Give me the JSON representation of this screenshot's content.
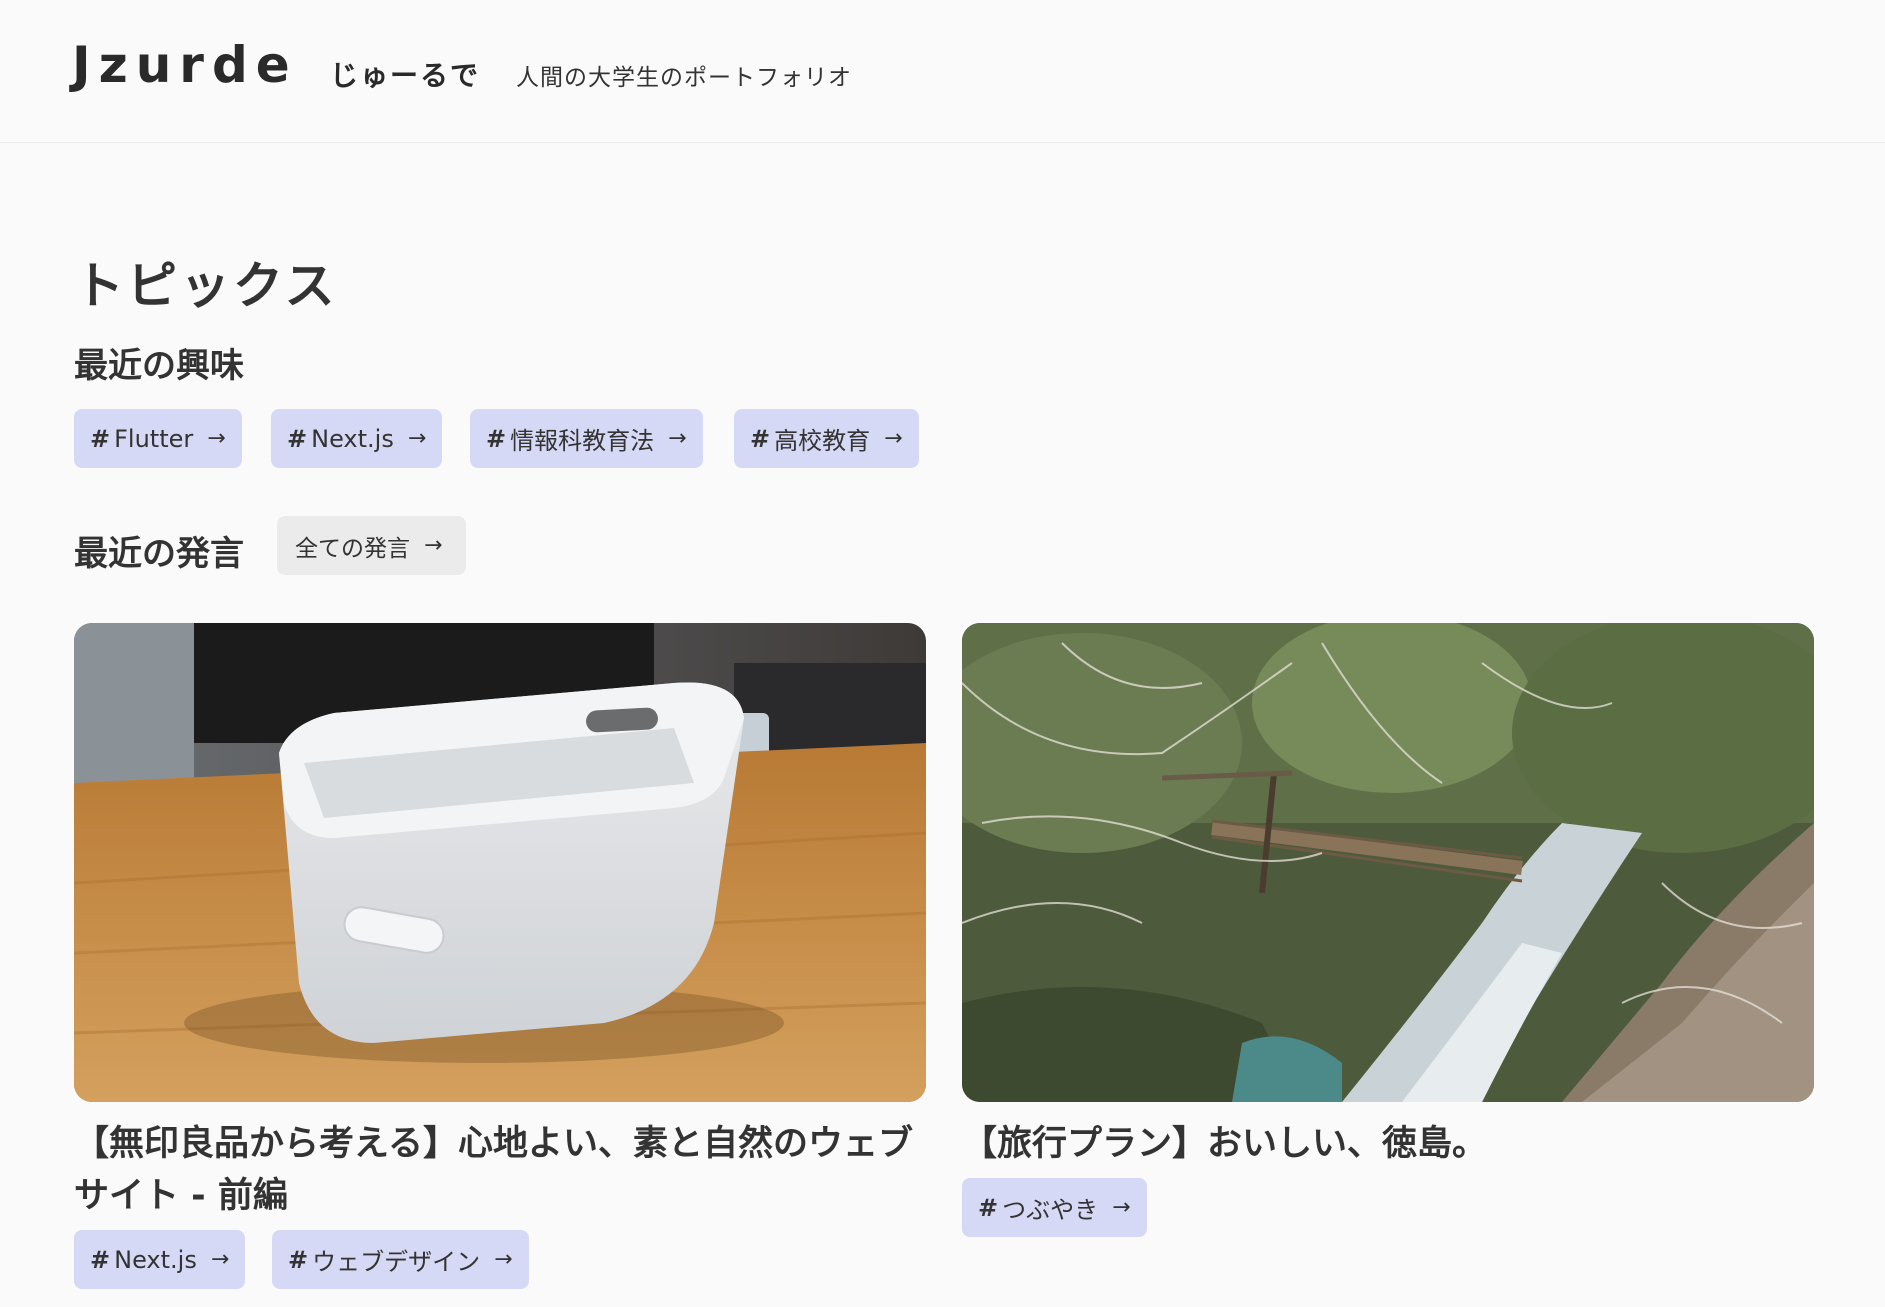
{
  "header": {
    "logo": "Jzurde",
    "logo_kana": "じゅーるで",
    "tagline": "人間の大学生のポートフォリオ"
  },
  "page": {
    "title": "トピックス"
  },
  "interests": {
    "title": "最近の興味",
    "tags": [
      {
        "hash": "#",
        "label": "Flutter",
        "arrow": "→"
      },
      {
        "hash": "#",
        "label": "Next.js",
        "arrow": "→"
      },
      {
        "hash": "#",
        "label": "情報科教育法",
        "arrow": "→"
      },
      {
        "hash": "#",
        "label": "高校教育",
        "arrow": "→"
      }
    ]
  },
  "posts": {
    "title": "最近の発言",
    "all_label": "全ての発言",
    "all_arrow": "→",
    "items": [
      {
        "title": "【無印良品から考える】心地よい、素と自然のウェブサイト - 前編",
        "image": "white-storage-box-on-wooden-desk",
        "tags": [
          {
            "hash": "#",
            "label": "Next.js",
            "arrow": "→"
          },
          {
            "hash": "#",
            "label": "ウェブデザイン",
            "arrow": "→"
          }
        ]
      },
      {
        "title": "【旅行プラン】おいしい、徳島。",
        "image": "vine-bridge-over-river-valley",
        "tags": [
          {
            "hash": "#",
            "label": "つぶやき",
            "arrow": "→"
          }
        ]
      }
    ]
  }
}
